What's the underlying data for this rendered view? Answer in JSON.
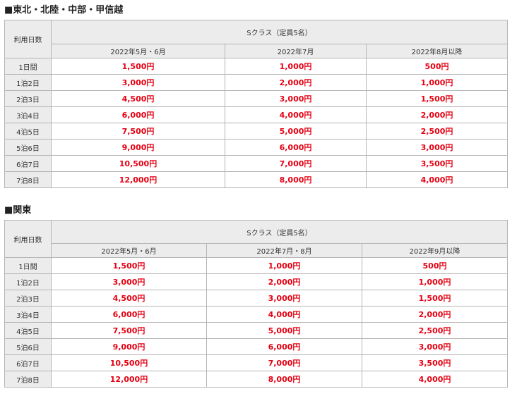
{
  "sections": [
    {
      "title": "■東北・北陸・中部・甲信越",
      "days_header": "利用日数",
      "class_header": "Sクラス（定員5名）",
      "periods": [
        "2022年5月・6月",
        "2022年7月",
        "2022年8月以降"
      ],
      "rows": [
        {
          "day": "1日間",
          "prices": [
            "1,500円",
            "1,000円",
            "500円"
          ]
        },
        {
          "day": "1泊2日",
          "prices": [
            "3,000円",
            "2,000円",
            "1,000円"
          ]
        },
        {
          "day": "2泊3日",
          "prices": [
            "4,500円",
            "3,000円",
            "1,500円"
          ]
        },
        {
          "day": "3泊4日",
          "prices": [
            "6,000円",
            "4,000円",
            "2,000円"
          ]
        },
        {
          "day": "4泊5日",
          "prices": [
            "7,500円",
            "5,000円",
            "2,500円"
          ]
        },
        {
          "day": "5泊6日",
          "prices": [
            "9,000円",
            "6,000円",
            "3,000円"
          ]
        },
        {
          "day": "6泊7日",
          "prices": [
            "10,500円",
            "7,000円",
            "3,500円"
          ]
        },
        {
          "day": "7泊8日",
          "prices": [
            "12,000円",
            "8,000円",
            "4,000円"
          ]
        }
      ]
    },
    {
      "title": "■関東",
      "days_header": "利用日数",
      "class_header": "Sクラス（定員5名）",
      "periods": [
        "2022年5月・6月",
        "2022年7月・8月",
        "2022年9月以降"
      ],
      "rows": [
        {
          "day": "1日間",
          "prices": [
            "1,500円",
            "1,000円",
            "500円"
          ]
        },
        {
          "day": "1泊2日",
          "prices": [
            "3,000円",
            "2,000円",
            "1,000円"
          ]
        },
        {
          "day": "2泊3日",
          "prices": [
            "4,500円",
            "3,000円",
            "1,500円"
          ]
        },
        {
          "day": "3泊4日",
          "prices": [
            "6,000円",
            "4,000円",
            "2,000円"
          ]
        },
        {
          "day": "4泊5日",
          "prices": [
            "7,500円",
            "5,000円",
            "2,500円"
          ]
        },
        {
          "day": "5泊6日",
          "prices": [
            "9,000円",
            "6,000円",
            "3,000円"
          ]
        },
        {
          "day": "6泊7日",
          "prices": [
            "10,500円",
            "7,000円",
            "3,500円"
          ]
        },
        {
          "day": "7泊8日",
          "prices": [
            "12,000円",
            "8,000円",
            "4,000円"
          ]
        }
      ]
    }
  ],
  "colors": {
    "price_text": "#e60012",
    "header_bg": "#ececec",
    "border": "#b5b5b5"
  }
}
